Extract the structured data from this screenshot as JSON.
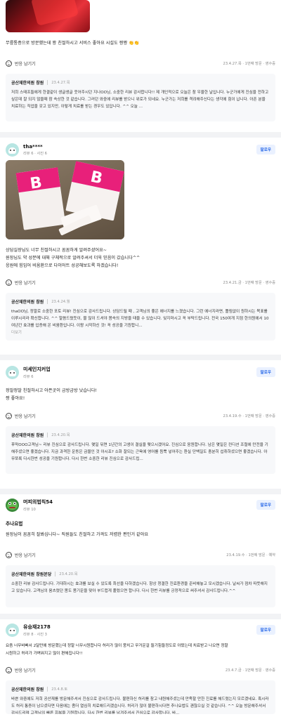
{
  "common": {
    "reply_button": "반응 남기기",
    "follow_label": "팔로우",
    "owner_name": "공산재한의원 창원",
    "more": "더보기"
  },
  "review_top": {
    "body": "무릎통증으로 방문했는데 꽝 친절하시고 서비스 좋아요 시설도 짱짱 👏👏",
    "meta": "23.4.27.목 · 1번째 방문 · 영수증",
    "reply_date": "23.4.27.목",
    "reply_text": "저희 스태프들에게 한결같이 생글생글 웃어주시던 지나OO님, 소중한 리뷰 감사합니다!! 제 개인적으로 오늘은 참 우울한 날입니다. 누군가에게 진심을 전하고 싶은데 잘 되지 않을때 참 속상한 것 같습니다. 그러던 와중에 리뷰를 받으니 위로가 되네요. 누군가는 저희를 격려해주신다는 생각에 힘이 납니다. 아픈 분을 치료하는 직업을 갖고 있지만, 이렇게 치료를 받는 경우도 있답니다. ^^ 오늘 ..."
  },
  "review_tha": {
    "username": "tha****",
    "stats": "리뷰 6 · 사진 6",
    "body_lines": [
      "상담실장님도 너무 친절하시고 꼼꼼하게 알려주셨어요~",
      "원장님도 약 성분에 대해 구체적으로 알려주셔서 더욱 믿음이 갔습니다^^",
      "응원에 힘입어 비움환으로 다이어트 성공해보도록 하겠습니다!"
    ],
    "meta": "23.4.21.금 · 1번째 방문 · 영수증",
    "reply_owner": "공산재한의원 창원",
    "reply_date": "23.4.24.월",
    "reply_text": "thaOO님, 정말로 소중한 포토 리뷰! 진심으로 감사드립니다. 상담드릴 때 , 고객님의 좋은 에너지를 느꼈습니다. 그런 에너지라면, 틀림없이 원하시는 목표를 이루시리라 확신합니다. ^^ 말씀드렸듯이, 물 많이 드셔야 몸속의 지방을 태울 수 있습니다. 잊지마시고 꼭 부탁드립니다. 전국 150여개 지점 한의원에서 10여년간 효과를 입증해 온 비움환입니다. 이왕 시작하신 것! 꼭 성공을 기원합니...",
    "more": "더보기"
  },
  "review_mise": {
    "username": "미세인지커업",
    "stats": "리뷰 6",
    "body_lines": [
      "정말정말 친절하시고 아픈곳이 금방금방 낫습니다!",
      "짱 좋아요!"
    ],
    "meta": "23.4.19.수 · 1번째 방문 · 영수증",
    "reply_date": "23.4.20.목",
    "reply_text": "후막OOO고객님~ 리뷰 진심으로 감사드립니다. 몇일 뒤면 1년간의 고생이 결실을 맺으시겠어요. 진심으로 응원합니다. 남은 몇일은 컨디션 조절에 만전을 기해주셨으면 좋겠습니다. 지금 과격한 운동은 금물인 것 아시죠? 소화 잘되는 근육에 영어를 듬뿍 넣어주는 환실 단백질도 충분히 섭취하셨으면 좋겠습니다. 아무쪼록 다시한번 성공을 기원합니다. 다시 한번 소중한 리뷰 진심으로 감사드립..."
  },
  "review_frog": {
    "username": "머피의법칙54",
    "stats": "리뷰 10",
    "title": "추나요법",
    "body": "원장님이 꼼꼼히 잘봐십니다~ 직원들도 친절하고 가격도 저렴한 편인거 같아요",
    "meta": "23.4.19.수 · 1번째 방문 · 예약",
    "reply_owner": "공산재한의원 창원본당",
    "reply_date": "23.4.20.목",
    "reply_text": "소중한 리뷰 감사드립니다. 기대하시는 효과를 보실 수 있도록 최선을 다하겠습니다. 항상 청결한 진료환경을 준비해놓고 모시겠습니다. 날씨가 점차 따뜻해지고 있습니다. 고객님의 움츠렸던 몸도 봄기운을 맞아 부드럽게 풀렸으면 합니다. 다시 한번 리뷰를 긍정적으로 써주셔서 감사드립니다.^^"
  },
  "review_yu": {
    "username": "유승재2178",
    "stats": "리뷰 8 · 사진 3",
    "body_lines": [
      "요즘 너무바빠서 2달만에 방문했는데 정말 너무시원합니다 허리가 많이 뭉치고 무거운걸 들기힘들정도로 아팠는데 치료받고 나오면 정말",
      "시원하고 허리가 가벼워지고 많이 편해집니다!!"
    ],
    "meta": "23.4.7.금 · 1번째 방문 · 영수증",
    "reply_date": "23.4.8.토",
    "reply_text": "바쁜 와중에도 저희 공산재를 방문해주셔서 진심으로 감사드립니다. 불편하신 허리를 참고 내원해주셨는데 만족할 만한 진료를 해드렸는지 모르겠네요. 혹시라도 허리 통증이 남으셨다면 다음에는 좀더 열심히 치료해드리겠습니다. 허리가 많이 불편하시다면 추나요법도 괜찮으실 것 같습니다. ^^ 오늘 방문해주셔서 감사드리며 고객님의 빠른 회복을 기원합니다. 다시 한번 리뷰를 남겨주셔서 진심으로 감사합니다. 바..."
  }
}
